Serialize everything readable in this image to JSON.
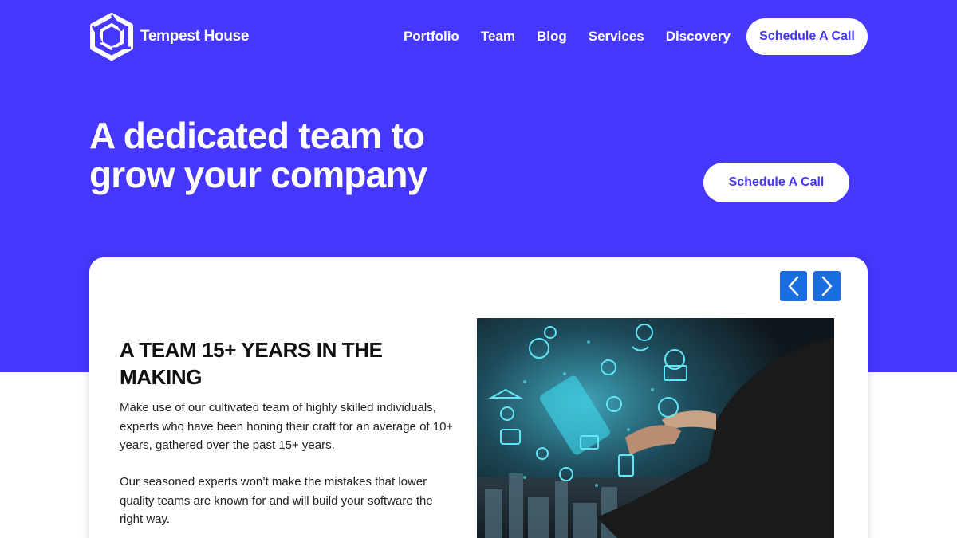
{
  "brand": {
    "name": "Tempest House",
    "logo_icon": "hexagon-logo-icon"
  },
  "nav": {
    "links": [
      "Portfolio",
      "Team",
      "Blog",
      "Services",
      "Discovery"
    ],
    "cta_label": "Schedule A Call"
  },
  "hero": {
    "title_line1": "A dedicated team to",
    "title_line2": "grow your company",
    "cta_label": "Schedule A Call"
  },
  "card": {
    "prev_icon": "chevron-left-icon",
    "next_icon": "chevron-right-icon",
    "title_line1": "A TEAM 15+ YEARS IN THE",
    "title_line2": "MAKING",
    "paragraph1": "Make use of our cultivated team of highly skilled individuals, experts who have been honing their craft for an average of 10+ years, gathered over the past 15+ years.",
    "paragraph2": "Our seasoned experts won’t make the mistakes that lower quality teams are known for and will build your software the right way."
  },
  "colors": {
    "brand_blue": "#4537fb",
    "arrow_blue": "#1a6de0",
    "white": "#ffffff",
    "text_dark": "#111111"
  }
}
